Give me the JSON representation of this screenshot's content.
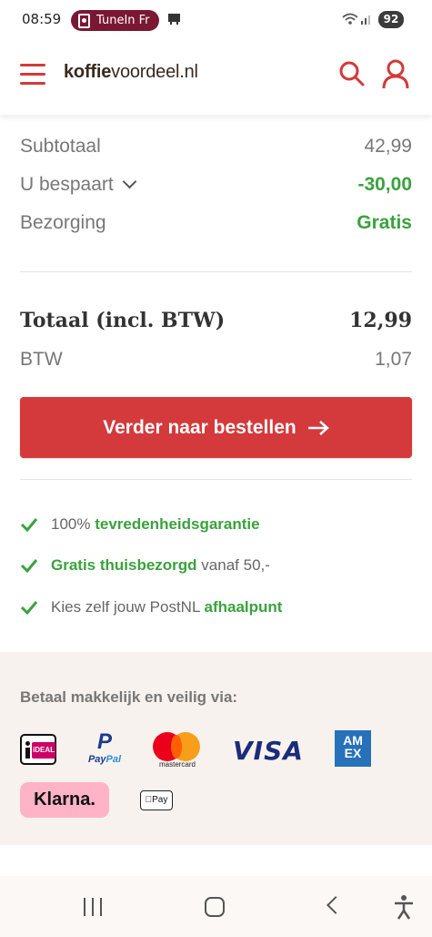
{
  "status_bar": {
    "time": "08:59",
    "app_label": "TuneIn Fr",
    "battery": "92"
  },
  "header": {
    "logo_bold": "koffie",
    "logo_rest": "voordeel.nl"
  },
  "summary": {
    "subtotaal_label": "Subtotaal",
    "subtotaal_value": "42,99",
    "bespaart_label": "U bespaart",
    "bespaart_value": "-30,00",
    "bezorging_label": "Bezorging",
    "bezorging_value": "Gratis",
    "totaal_label": "Totaal (incl. BTW)",
    "totaal_value": "12,99",
    "btw_label": "BTW",
    "btw_value": "1,07"
  },
  "cta": {
    "label": "Verder naar bestellen"
  },
  "benefits": [
    {
      "prefix": "100% ",
      "highlight": "tevredenheidsgarantie",
      "suffix": ""
    },
    {
      "prefix": "",
      "highlight": "Gratis thuisbezorgd",
      "suffix": " vanaf 50,-"
    },
    {
      "prefix": "Kies zelf jouw PostNL ",
      "highlight": "afhaalpunt",
      "suffix": ""
    }
  ],
  "payment": {
    "title": "Betaal makkelijk en veilig via:",
    "methods": [
      "iDEAL",
      "PayPal",
      "mastercard",
      "VISA",
      "AMEX",
      "Klarna.",
      "Apple Pay"
    ],
    "ideal_text": "iDEAL",
    "paypal_text_a": "Pay",
    "paypal_text_b": "Pal",
    "mastercard_text": "mastercard",
    "visa_text": "VISA",
    "amex_line1": "AM",
    "amex_line2": "EX",
    "klarna_text": "Klarna.",
    "applepay_text": "Pay"
  },
  "colors": {
    "brand_red": "#d4393b",
    "success_green": "#3aa23d",
    "pay_bg": "#f7f2ee"
  }
}
